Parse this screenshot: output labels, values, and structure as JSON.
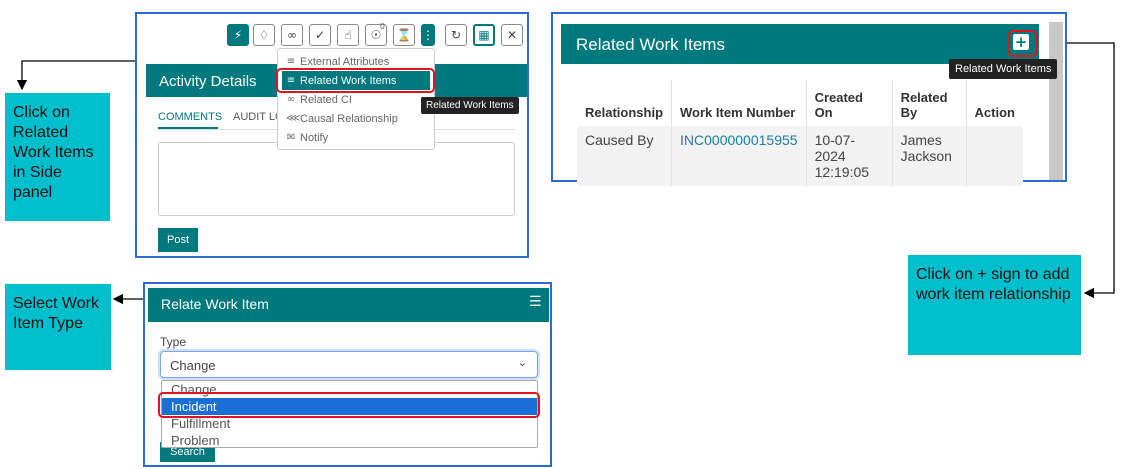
{
  "callouts": {
    "side_panel": "Click on Related Work Items in Side panel",
    "plus_sign": "Click on + sign to add work item relationship",
    "select_type": "Select Work Item Type"
  },
  "activity_panel": {
    "toolbar_icons": [
      "activity-icon",
      "tag-icon",
      "paperclip-icon",
      "clipboard-check-icon",
      "thumbs-up-icon",
      "eye-icon",
      "hourglass-icon",
      "more-vertical-icon",
      "refresh-icon",
      "save-icon",
      "close-icon"
    ],
    "eye_badge": "0",
    "title": "Activity Details",
    "tabs": [
      "COMMENTS",
      "AUDIT LO"
    ],
    "post_label": "Post",
    "menu": [
      {
        "label": "External Attributes",
        "icon": "list-icon"
      },
      {
        "label": "Related Work Items",
        "icon": "hierarchy-icon"
      },
      {
        "label": "Related CI",
        "icon": "link-icon"
      },
      {
        "label": "Causal Relationship",
        "icon": "share-icon"
      },
      {
        "label": "Notify",
        "icon": "megaphone-icon"
      }
    ],
    "tooltip": "Related Work Items"
  },
  "related_panel": {
    "title": "Related Work Items",
    "tooltip": "Related Work Items",
    "columns": [
      "Relationship",
      "Work Item Number",
      "Created On",
      "Related By",
      "Action"
    ],
    "rows": [
      {
        "relationship": "Caused By",
        "number": "INC000000015955",
        "created_on": "10-07-2024 12:19:05",
        "related_by": "James Jackson",
        "action": ""
      }
    ]
  },
  "relate_panel": {
    "title": "Relate Work Item",
    "type_label": "Type",
    "selected": "Change",
    "options": [
      "Change",
      "Incident",
      "Fulfillment",
      "Problem"
    ],
    "highlighted": "Incident",
    "search_label": "Search"
  },
  "colors": {
    "teal": "#00797e",
    "callout": "#00bfcc",
    "frame": "#2a6bd1",
    "highlight": "#e0141e"
  }
}
